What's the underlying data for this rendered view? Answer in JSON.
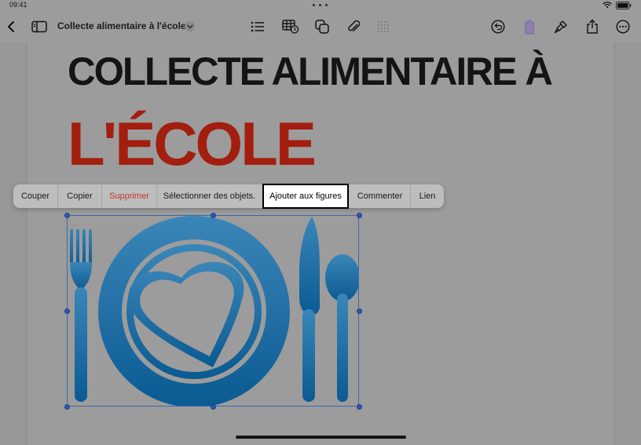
{
  "status": {
    "time": "09:41"
  },
  "toolbar": {
    "document_title": "Collecte alimentaire à l'école",
    "icons": [
      "back-icon",
      "sidebar-icon",
      "list-icon",
      "table-icon",
      "shapes-icon",
      "attachment-icon",
      "grid-icon",
      "undo-icon",
      "document-icon",
      "format-icon",
      "share-icon",
      "more-icon"
    ]
  },
  "document": {
    "heading_line1": "COLLECTE ALIMENTAIRE À",
    "heading_line2": "L'ÉCOLE"
  },
  "edit_menu": {
    "items": [
      {
        "label": "Couper"
      },
      {
        "label": "Copier"
      },
      {
        "label": "Supprimer"
      },
      {
        "label": "Sélectionner des objets."
      },
      {
        "label": "Ajouter aux figures"
      },
      {
        "label": "Commenter"
      },
      {
        "label": "Lien"
      }
    ]
  },
  "colors": {
    "background": "#9c9c9c",
    "heading_black": "#141414",
    "heading_red": "#a31e0e",
    "destructive": "#c0392b",
    "graphic_blue_top": "#3b86b8",
    "graphic_blue_bottom": "#0a5a93",
    "selection": "#2d58b8"
  }
}
